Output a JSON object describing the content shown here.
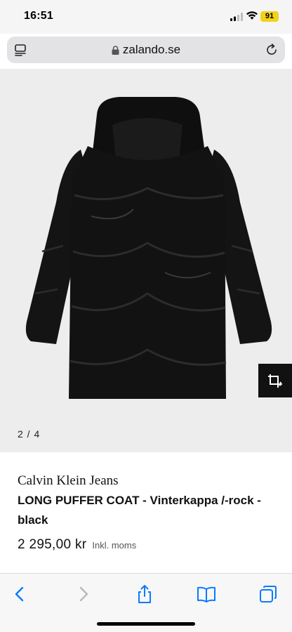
{
  "status": {
    "time": "16:51",
    "battery": "91",
    "battery_color": "#f2d21b"
  },
  "browser": {
    "url": "zalando.se",
    "menu_icon": "page-menu-icon",
    "lock_icon": "lock-icon",
    "reload_icon": "reload-icon"
  },
  "gallery": {
    "pager": "2 / 4",
    "current_image": 2,
    "total_images": 4,
    "tryon_icon": "crop-rotate-icon"
  },
  "product": {
    "brand": "Calvin Klein Jeans",
    "name": "LONG PUFFER COAT - Vinterkappa /-rock - black",
    "price": "2 295,00 kr",
    "vat_note": "Inkl. moms"
  },
  "toolbar": {
    "items": [
      "back-icon",
      "forward-icon",
      "share-icon",
      "bookmarks-icon",
      "tabs-icon"
    ],
    "accent": "#0a7aff",
    "disabled": "#b9b9bd"
  }
}
